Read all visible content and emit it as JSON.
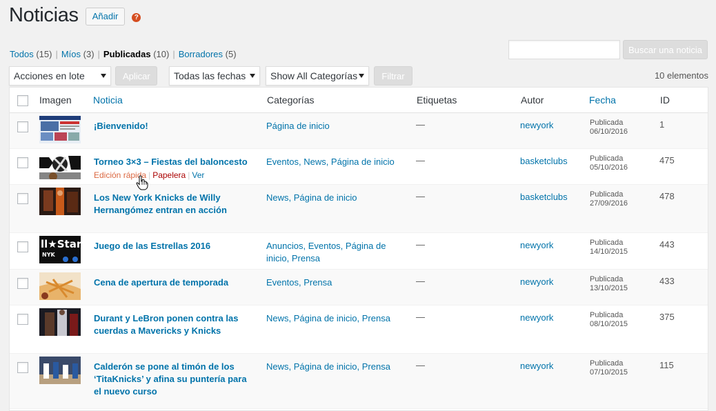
{
  "header": {
    "title": "Noticias",
    "add_label": "Añadir",
    "help_glyph": "?"
  },
  "views": [
    {
      "label": "Todos",
      "count": "(15)"
    },
    {
      "label": "Míos",
      "count": "(3)"
    },
    {
      "label": "Publicadas",
      "count": "(10)",
      "current": true
    },
    {
      "label": "Borradores",
      "count": "(5)"
    }
  ],
  "search": {
    "value": "",
    "button": "Buscar una noticia"
  },
  "tablenav": {
    "bulk": "Acciones en lote",
    "apply": "Aplicar",
    "dates": "Todas las fechas",
    "categories": "Show All Categorías",
    "filter": "Filtrar",
    "items_count": "10 elementos"
  },
  "columns": {
    "image": "Imagen",
    "title": "Noticia",
    "categories": "Categorías",
    "tags": "Etiquetas",
    "author": "Autor",
    "date": "Fecha",
    "id": "ID"
  },
  "row_actions": {
    "edit": "Edición rápida",
    "trash": "Papelera",
    "view": "Ver"
  },
  "rows": [
    {
      "title": "¡Bienvenido!",
      "categories": "Página de inicio",
      "tags": "—",
      "author": "newyork",
      "status": "Publicada",
      "date": "06/10/2016",
      "id": "1"
    },
    {
      "title": "Torneo 3×3 – Fiestas del baloncesto",
      "categories": "Eventos, News, Página de inicio",
      "tags": "—",
      "author": "basketclubs",
      "status": "Publicada",
      "date": "05/10/2016",
      "id": "475"
    },
    {
      "title": "Los New York Knicks de Willy Hernangómez entran en acción",
      "categories": "News, Página de inicio",
      "tags": "—",
      "author": "basketclubs",
      "status": "Publicada",
      "date": "27/09/2016",
      "id": "478"
    },
    {
      "title": "Juego de las Estrellas 2016",
      "categories": "Anuncios, Eventos, Página de inicio, Prensa",
      "tags": "—",
      "author": "newyork",
      "status": "Publicada",
      "date": "14/10/2015",
      "id": "443"
    },
    {
      "title": "Cena de apertura de temporada",
      "categories": "Eventos, Prensa",
      "tags": "—",
      "author": "newyork",
      "status": "Publicada",
      "date": "13/10/2015",
      "id": "433"
    },
    {
      "title": "Durant y LeBron ponen contra las cuerdas a Mavericks y Knicks",
      "categories": "News, Página de inicio, Prensa",
      "tags": "—",
      "author": "newyork",
      "status": "Publicada",
      "date": "08/10/2015",
      "id": "375"
    },
    {
      "title": "Calderón se pone al timón de los ‘TitaKnicks’ y afina su puntería para el nuevo curso",
      "categories": "News, Página de inicio, Prensa",
      "tags": "—",
      "author": "newyork",
      "status": "Publicada",
      "date": "07/10/2015",
      "id": "115"
    }
  ],
  "thumb_text": {
    "allstar_top": "ll★Star",
    "allstar_bottom": "NYK"
  }
}
